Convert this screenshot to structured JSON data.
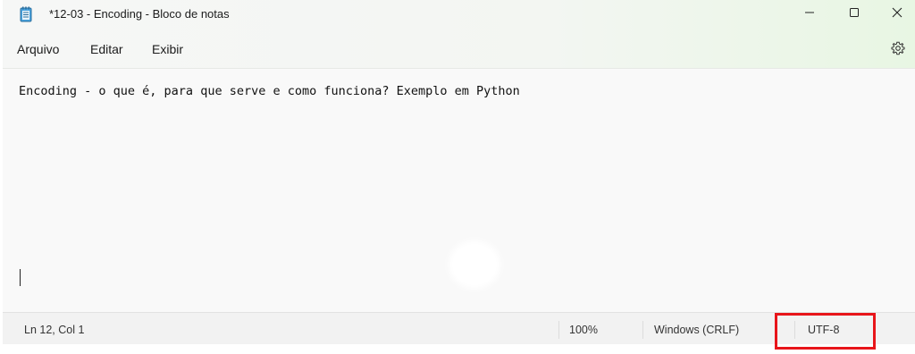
{
  "window": {
    "title": "*12-03 - Encoding - Bloco de notas",
    "app_icon": "notepad-icon"
  },
  "title_controls": {
    "minimize_icon": "minimize-icon",
    "maximize_icon": "maximize-icon",
    "close_icon": "close-icon"
  },
  "menu": {
    "items": [
      {
        "label": "Arquivo"
      },
      {
        "label": "Editar"
      },
      {
        "label": "Exibir"
      }
    ],
    "settings_icon": "gear-icon"
  },
  "editor": {
    "line1": "Encoding - o que é, para que serve e como funciona? Exemplo em Python"
  },
  "statusbar": {
    "position": "Ln 12, Col 1",
    "zoom": "100%",
    "line_ending": "Windows (CRLF)",
    "encoding": "UTF-8"
  },
  "colors": {
    "highlight": "#e8151a",
    "menubar_tint": "#e8f6e3"
  }
}
